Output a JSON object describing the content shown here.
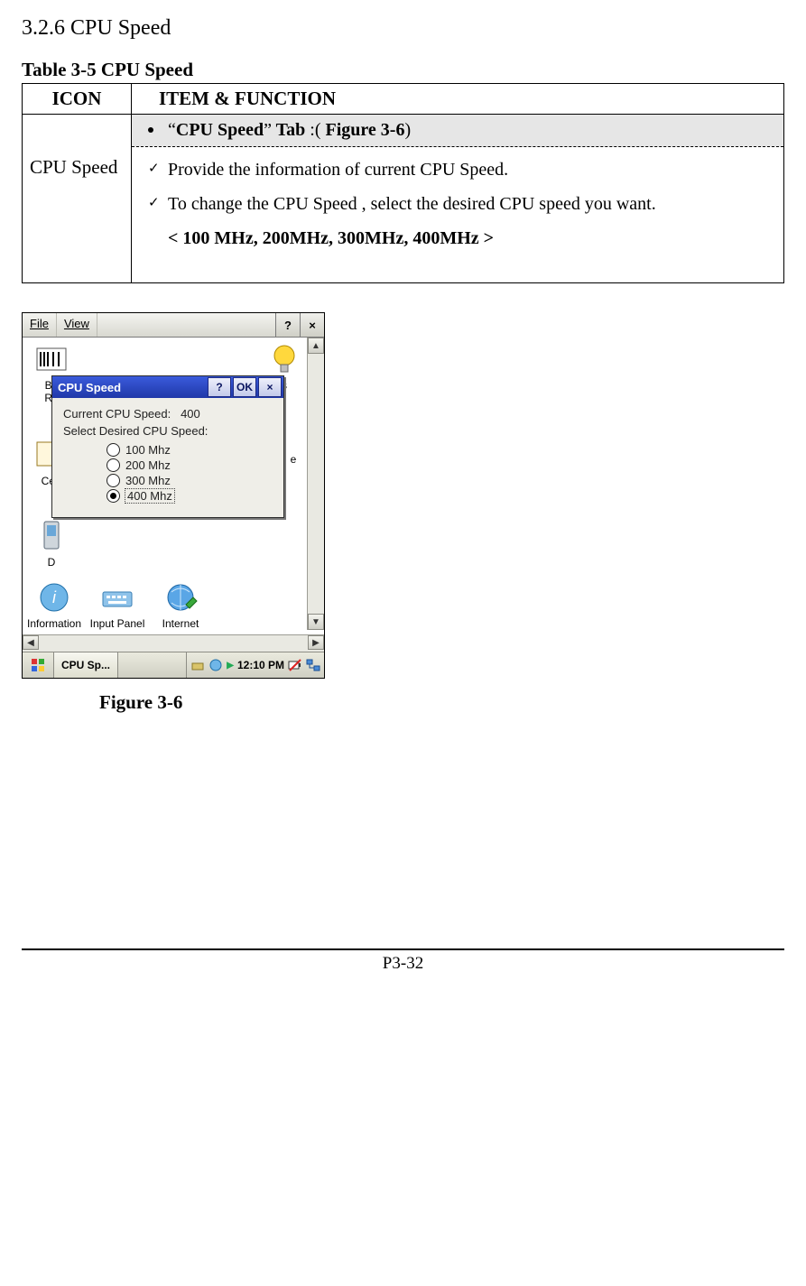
{
  "section_title": "3.2.6 CPU Speed",
  "table_caption": "Table 3-5 CPU Speed",
  "table": {
    "head_icon": "ICON",
    "head_item": "ITEM & FUNCTION",
    "icon_label": "CPU Speed",
    "tab_quote_open": "“",
    "tab_name": "CPU Speed",
    "tab_quote_close": "”",
    "tab_word": " Tab",
    "tab_colon": " :( ",
    "tab_figure": "Figure 3-6",
    "tab_close": ")",
    "row1": "Provide the information of current CPU Speed.",
    "row2": "To change the CPU Speed , select the desired CPU speed you want.",
    "row3": "< 100 MHz, 200MHz, 300MHz, 400MHz >"
  },
  "figure": {
    "caption": "Figure 3-6",
    "menubar": {
      "file": "File",
      "view": "View",
      "help": "?",
      "close": "×"
    },
    "dialog": {
      "title": "CPU Speed",
      "help": "?",
      "ok": "OK",
      "close": "×",
      "current_label": "Current CPU Speed:",
      "current_value": "400",
      "select_label": "Select Desired CPU Speed:",
      "options": [
        {
          "label": "100 Mhz",
          "selected": false
        },
        {
          "label": "200 Mhz",
          "selected": false
        },
        {
          "label": "300 Mhz",
          "selected": false
        },
        {
          "label": "400 Mhz",
          "selected": true
        }
      ]
    },
    "desk_labels": {
      "ba": "Ba",
      "re": "Re",
      "cert": "Cert",
      "d": "D",
      "s": "s",
      "e": "e",
      "info": "Information",
      "input": "Input Panel",
      "internet": "Internet"
    },
    "taskbar": {
      "task_label": "CPU Sp...",
      "time": "12:10 PM"
    }
  },
  "page_number": "P3-32"
}
